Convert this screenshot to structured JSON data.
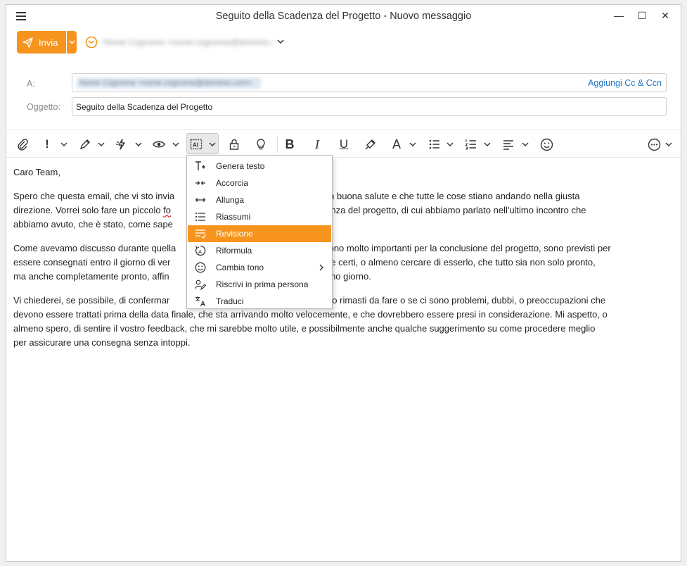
{
  "window": {
    "title": "Seguito della Scadenza del Progetto - Nuovo messaggio",
    "minimize_glyph": "—",
    "maximize_glyph": "☐",
    "close_glyph": "✕"
  },
  "send": {
    "label": "Invia"
  },
  "from": {
    "value": "Nome Cognome <nome.cognome@dominio.com>"
  },
  "to": {
    "label": "A:",
    "recipient": "Nome Cognome <nome.cognome@dominio.com>",
    "cc_link": "Aggiungi Cc & Ccn"
  },
  "subject": {
    "label": "Oggetto:",
    "value": "Seguito della Scadenza del Progetto"
  },
  "toolbar": {
    "priority_glyph": "!",
    "bold_glyph": "B",
    "italic_glyph": "I",
    "underline_glyph": "U",
    "font_glyph": "A",
    "icons": [
      "paperclip-icon",
      "priority-icon",
      "signature-pen-icon",
      "quick-actions-icon",
      "eye-icon",
      "ai-assistant-icon",
      "lock-icon",
      "lightbulb-icon",
      "bold-icon",
      "italic-icon",
      "underline-icon",
      "format-painter-icon",
      "font-color-icon",
      "bullet-list-icon",
      "numbered-list-icon",
      "align-icon",
      "emoji-icon",
      "more-icon"
    ]
  },
  "body": {
    "greeting": "Caro Team,",
    "p1_a": "Spero che questa email, che vi sto invia",
    "p1_b": "vi trovi in buona salute e che tutte le cose stiano andando nella giusta",
    "p1_c": "direzione. Vorrei solo fare un piccolo ",
    "p1_d": "fo",
    "p1_e": "lla scadenza del progetto, di cui abbiamo parlato nell'ultimo incontro che",
    "p1_f": "abbiamo avuto, che è stato, come sape",
    "p2_a": "Come avevamo discusso durante quella",
    "p2_b": "e sono molto importanti per la conclusione del progetto, sono previsti per",
    "p2_c": "essere consegnati entro il giorno di ver",
    "p2_d": "utamente certi, o almeno cercare di esserlo, che tutto sia non solo pronto,",
    "p2_e": "ma anche completamente pronto, affin",
    "p2_f": "e l'ultimo giorno.",
    "p3_a": "Vi chiederei, se possibile, di confermar",
    "p3_b": "sono rimasti da fare o se ci sono problemi, dubbi, o preoccupazioni che",
    "p3_c": "devono essere trattati prima della data finale, che sta arrivando molto velocemente, e che dovrebbero essere presi in considerazione. Mi aspetto, o",
    "p3_d": "almeno spero, di sentire il vostro feedback, che mi sarebbe molto utile, e possibilmente anche qualche suggerimento su come procedere meglio",
    "p3_e": "per assicurare una consegna senza intoppi."
  },
  "ai_menu": {
    "items": [
      {
        "label": "Genera testo",
        "icon": "generate-text-icon"
      },
      {
        "label": "Accorcia",
        "icon": "shorten-icon"
      },
      {
        "label": "Allunga",
        "icon": "lengthen-icon"
      },
      {
        "label": "Riassumi",
        "icon": "summarize-icon"
      },
      {
        "label": "Revisione",
        "icon": "review-icon",
        "selected": true
      },
      {
        "label": "Riformula",
        "icon": "rephrase-icon"
      },
      {
        "label": "Cambia tono",
        "icon": "smiley-icon",
        "submenu": true
      },
      {
        "label": "Riscrivi in prima persona",
        "icon": "rewrite-icon"
      },
      {
        "label": "Traduci",
        "icon": "translate-icon"
      }
    ]
  },
  "colors": {
    "accent": "#f7941d",
    "link": "#1f74c8"
  }
}
